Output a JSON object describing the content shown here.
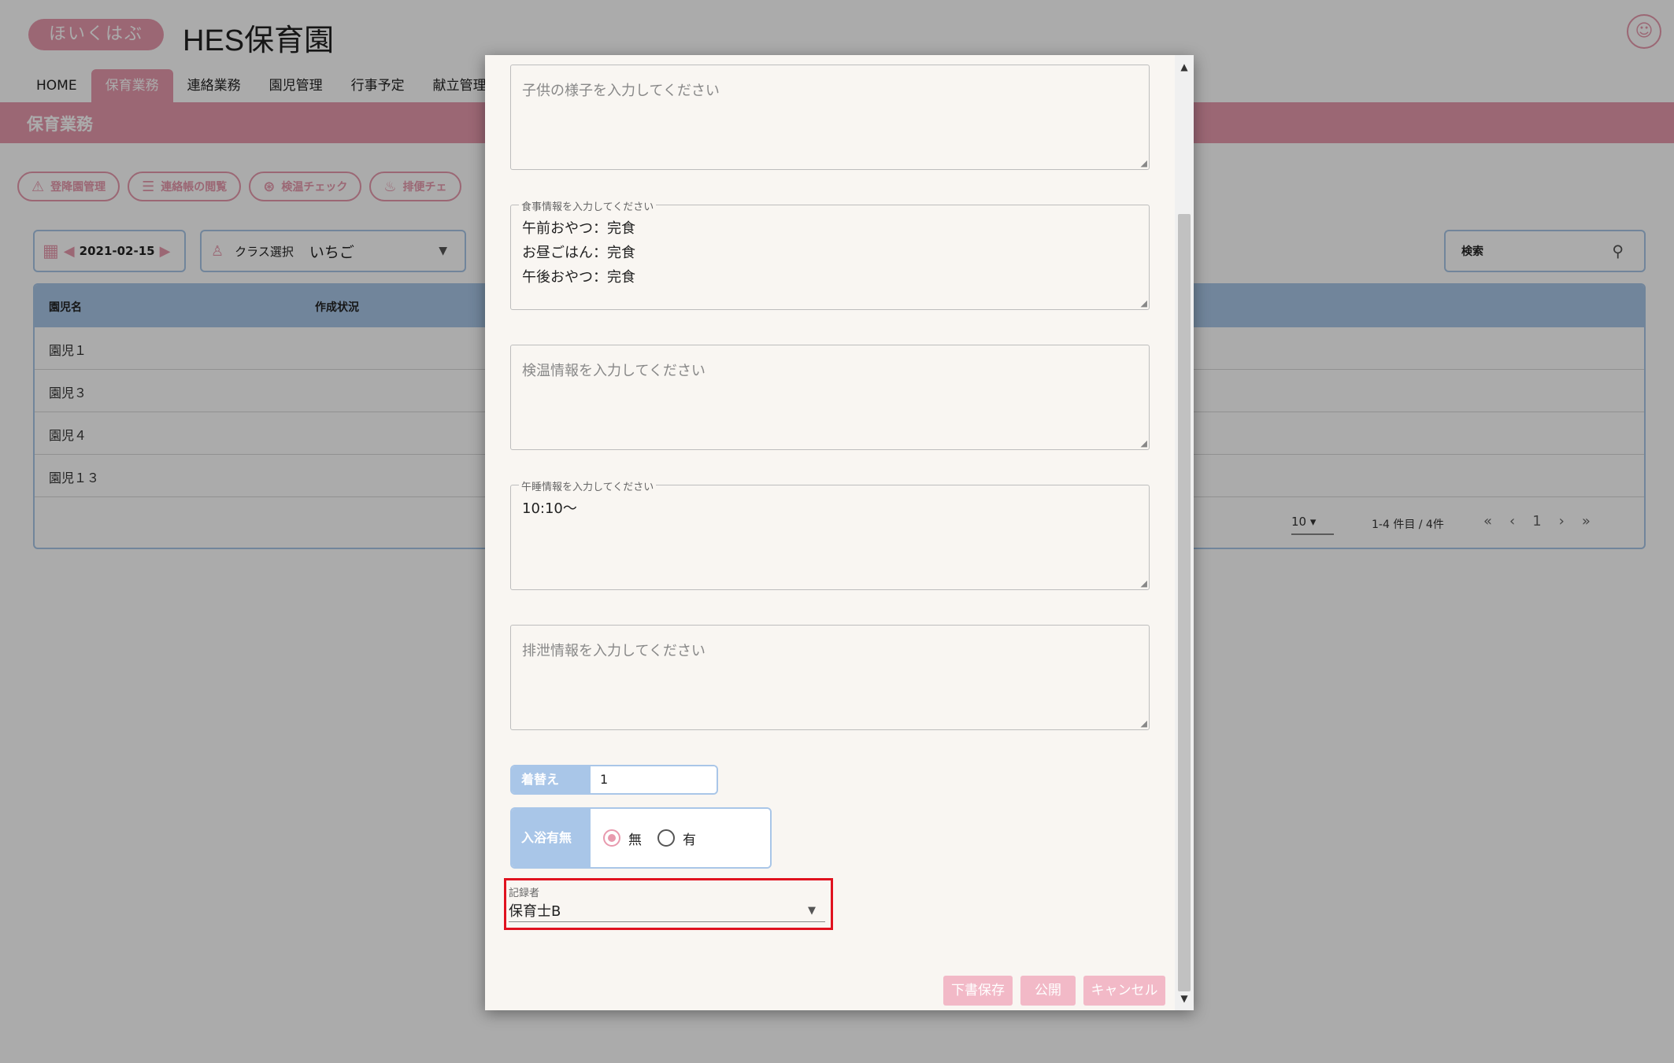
{
  "app": {
    "logo_text": "ほいくはぶ",
    "site_title": "HES保育園",
    "nav_tabs": [
      "HOME",
      "保育業務",
      "連絡業務",
      "園児管理",
      "行事予定",
      "献立管理"
    ],
    "section_title": "保育業務",
    "chips": [
      {
        "label": "登降園管理",
        "icon": "clipboard-icon"
      },
      {
        "label": "連絡帳の閲覧",
        "icon": "list-icon"
      },
      {
        "label": "検温チェック",
        "icon": "thermometer-icon"
      },
      {
        "label": "排便チェ",
        "icon": "duck-icon"
      }
    ],
    "date": "2021-02-15",
    "class_select_label": "クラス選択",
    "class_select_value": "いちご",
    "search_label": "検索",
    "table": {
      "headers": [
        "園児名",
        "作成状況"
      ],
      "rows": [
        "園児１",
        "園児３",
        "園児４",
        "園児１３"
      ]
    },
    "pager": {
      "page_size": "10",
      "range": "1-4 件目 / 4件",
      "page": "1"
    }
  },
  "dialog": {
    "child_state_placeholder": "子供の様子を入力してください",
    "meal_legend": "食事情報を入力してください",
    "meal_value": "午前おやつ：完食\nお昼ごはん：完食\n午後おやつ：完食",
    "temp_placeholder": "検温情報を入力してください",
    "nap_legend": "午睡情報を入力してください",
    "nap_value": "10:10〜",
    "excretion_placeholder": "排泄情報を入力してください",
    "change_label": "着替え",
    "change_value": "1",
    "bath_label": "入浴有無",
    "bath_options": [
      "無",
      "有"
    ],
    "bath_selected": "無",
    "recorder_label": "記録者",
    "recorder_value": "保育士B",
    "buttons": {
      "draft": "下書保存",
      "publish": "公開",
      "cancel": "キャンセル"
    }
  },
  "colors": {
    "brand_pink": "#e89aae",
    "accent_blue": "#a9c6e8",
    "highlight_red": "#e0121f"
  }
}
